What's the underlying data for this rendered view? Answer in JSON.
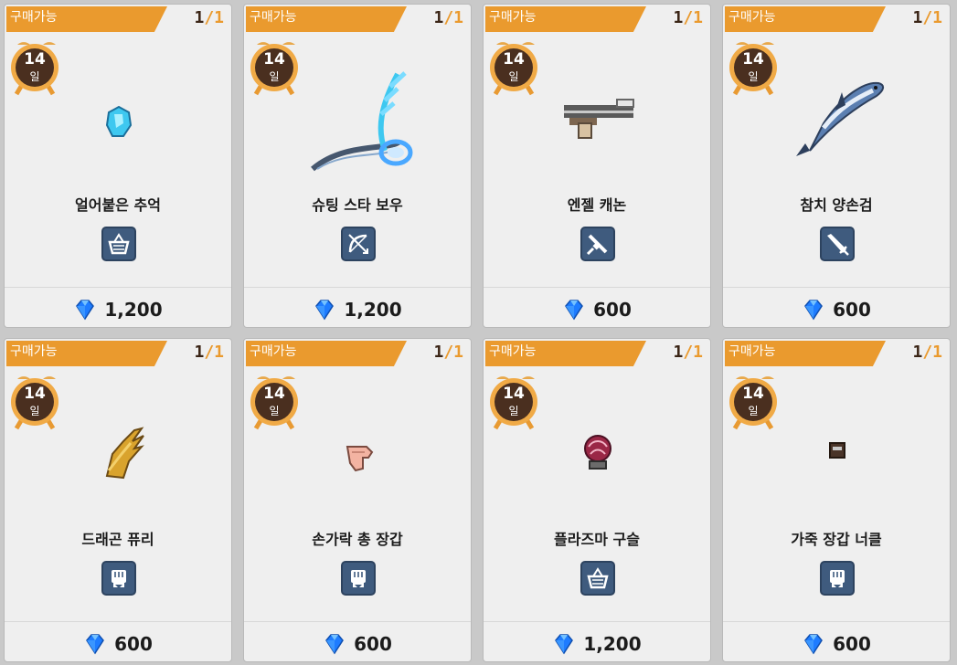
{
  "shop": {
    "cards": [
      {
        "badge": "구매가능",
        "stock_current": "1",
        "stock_sep": "/",
        "stock_max": "1",
        "timer_value": "14",
        "timer_unit": "일",
        "item_name": "얼어붙은 추억",
        "category_icon": "basket-icon",
        "price": "1,200",
        "item_icon": "frozen-gem-icon"
      },
      {
        "badge": "구매가능",
        "stock_current": "1",
        "stock_sep": "/",
        "stock_max": "1",
        "timer_value": "14",
        "timer_unit": "일",
        "item_name": "슈팅 스타 보우",
        "category_icon": "bow-icon",
        "price": "1,200",
        "item_icon": "ice-bow-icon"
      },
      {
        "badge": "구매가능",
        "stock_current": "1",
        "stock_sep": "/",
        "stock_max": "1",
        "timer_value": "14",
        "timer_unit": "일",
        "item_name": "엔젤 캐논",
        "category_icon": "gun-icon",
        "price": "600",
        "item_icon": "cannon-icon"
      },
      {
        "badge": "구매가능",
        "stock_current": "1",
        "stock_sep": "/",
        "stock_max": "1",
        "timer_value": "14",
        "timer_unit": "일",
        "item_name": "참치 양손검",
        "category_icon": "sword-icon",
        "price": "600",
        "item_icon": "tuna-sword-icon"
      },
      {
        "badge": "구매가능",
        "stock_current": "1",
        "stock_sep": "/",
        "stock_max": "1",
        "timer_value": "14",
        "timer_unit": "일",
        "item_name": "드래곤 퓨리",
        "category_icon": "fist-icon",
        "price": "600",
        "item_icon": "dragon-claw-icon"
      },
      {
        "badge": "구매가능",
        "stock_current": "1",
        "stock_sep": "/",
        "stock_max": "1",
        "timer_value": "14",
        "timer_unit": "일",
        "item_name": "손가락 총 장갑",
        "category_icon": "fist-icon",
        "price": "600",
        "item_icon": "finger-gun-glove-icon"
      },
      {
        "badge": "구매가능",
        "stock_current": "1",
        "stock_sep": "/",
        "stock_max": "1",
        "timer_value": "14",
        "timer_unit": "일",
        "item_name": "플라즈마 구슬",
        "category_icon": "basket-icon",
        "price": "1,200",
        "item_icon": "plasma-orb-icon"
      },
      {
        "badge": "구매가능",
        "stock_current": "1",
        "stock_sep": "/",
        "stock_max": "1",
        "timer_value": "14",
        "timer_unit": "일",
        "item_name": "가죽 장갑 너클",
        "category_icon": "fist-icon",
        "price": "600",
        "item_icon": "leather-knuckle-icon"
      }
    ]
  },
  "colors": {
    "banner": "#ea9a2e",
    "timer_bg": "#4a2f1f",
    "category_bg": "#3f5b7e",
    "gem": "#1e7cff"
  },
  "currency_icon": "blue-diamond-icon"
}
